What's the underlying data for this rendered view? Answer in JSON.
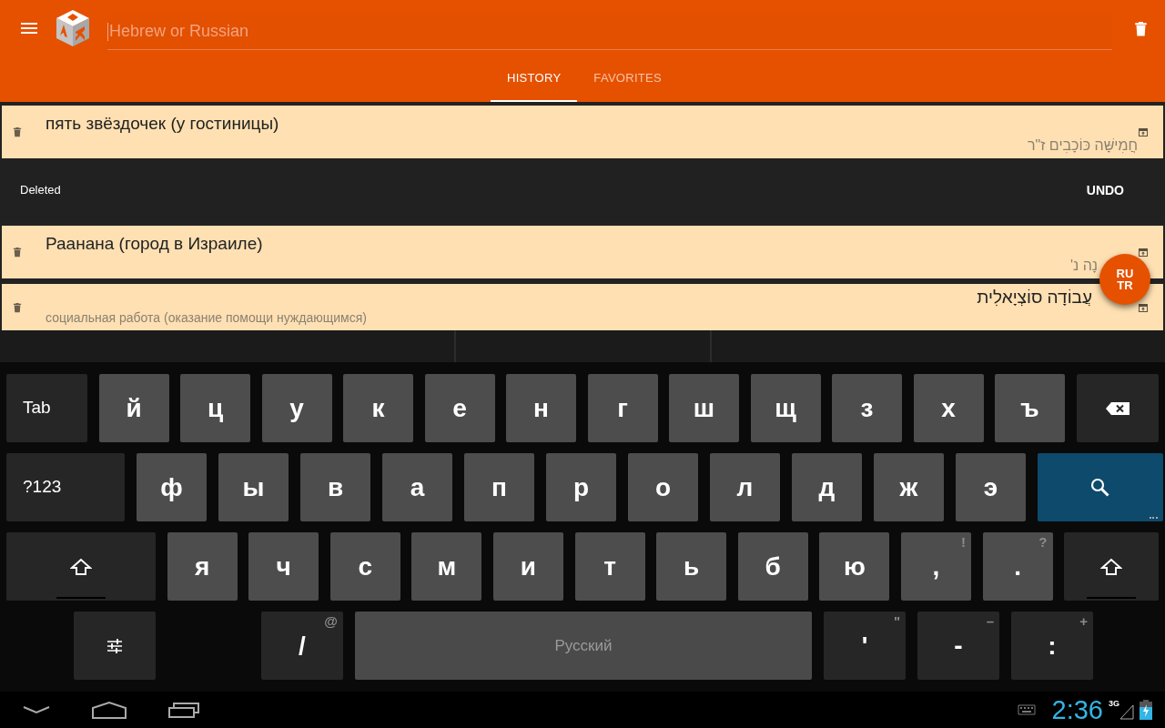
{
  "search": {
    "placeholder": "Hebrew or Russian"
  },
  "tabs": [
    {
      "label": "HISTORY",
      "selected": true
    },
    {
      "label": "FAVORITES",
      "selected": false
    }
  ],
  "entries": [
    {
      "kind": "ru",
      "primary": "пять звёздочек (у гостиницы)",
      "secondary": "חֲמִישָּׁה כּוֹכָבִים ז\"ר"
    },
    {
      "kind": "snackbar",
      "message": "Deleted",
      "action": "UNDO"
    },
    {
      "kind": "ru",
      "primary": "Раанана (город в Израиле)",
      "secondary": "נָה נ'"
    },
    {
      "kind": "he",
      "primary": "עֲבוֹדָה סוֹצְיָאלִית",
      "secondary": "социальная работа (оказание помощи нуждающимся)"
    }
  ],
  "fab": {
    "label": "RU TR"
  },
  "keyboard": {
    "rows": [
      {
        "keys": [
          {
            "kind": "function",
            "label": "Tab"
          },
          {
            "kind": "letter",
            "label": "й"
          },
          {
            "kind": "letter",
            "label": "ц"
          },
          {
            "kind": "letter",
            "label": "у"
          },
          {
            "kind": "letter",
            "label": "к"
          },
          {
            "kind": "letter",
            "label": "е"
          },
          {
            "kind": "letter",
            "label": "н"
          },
          {
            "kind": "letter",
            "label": "г"
          },
          {
            "kind": "letter",
            "label": "ш"
          },
          {
            "kind": "letter",
            "label": "щ"
          },
          {
            "kind": "letter",
            "label": "з"
          },
          {
            "kind": "letter",
            "label": "х"
          },
          {
            "kind": "letter",
            "label": "ъ"
          },
          {
            "kind": "backspace"
          }
        ]
      },
      {
        "keys": [
          {
            "kind": "function",
            "label": "?123"
          },
          {
            "kind": "letter",
            "label": "ф"
          },
          {
            "kind": "letter",
            "label": "ы"
          },
          {
            "kind": "letter",
            "label": "в"
          },
          {
            "kind": "letter",
            "label": "а"
          },
          {
            "kind": "letter",
            "label": "п"
          },
          {
            "kind": "letter",
            "label": "р"
          },
          {
            "kind": "letter",
            "label": "о"
          },
          {
            "kind": "letter",
            "label": "л"
          },
          {
            "kind": "letter",
            "label": "д"
          },
          {
            "kind": "letter",
            "label": "ж"
          },
          {
            "kind": "letter",
            "label": "э"
          },
          {
            "kind": "search"
          }
        ]
      },
      {
        "keys": [
          {
            "kind": "shift"
          },
          {
            "kind": "letter",
            "label": "я"
          },
          {
            "kind": "letter",
            "label": "ч"
          },
          {
            "kind": "letter",
            "label": "с"
          },
          {
            "kind": "letter",
            "label": "м"
          },
          {
            "kind": "letter",
            "label": "и"
          },
          {
            "kind": "letter",
            "label": "т"
          },
          {
            "kind": "letter",
            "label": "ь"
          },
          {
            "kind": "letter",
            "label": "б"
          },
          {
            "kind": "letter",
            "label": "ю"
          },
          {
            "kind": "letter",
            "label": ",",
            "hint": "!"
          },
          {
            "kind": "letter",
            "label": ".",
            "hint": "?"
          },
          {
            "kind": "shift"
          }
        ]
      },
      {
        "keys": [
          {
            "kind": "settings"
          },
          {
            "kind": "gap"
          },
          {
            "kind": "function",
            "label": "/",
            "hint": "@"
          },
          {
            "kind": "space",
            "label": "Русский"
          },
          {
            "kind": "function",
            "label": "'",
            "hint": "\""
          },
          {
            "kind": "function",
            "label": "-",
            "hint": "–"
          },
          {
            "kind": "function",
            "label": ":",
            "hint": "+"
          }
        ]
      }
    ]
  },
  "status": {
    "time": "2:36",
    "network": "3G"
  }
}
